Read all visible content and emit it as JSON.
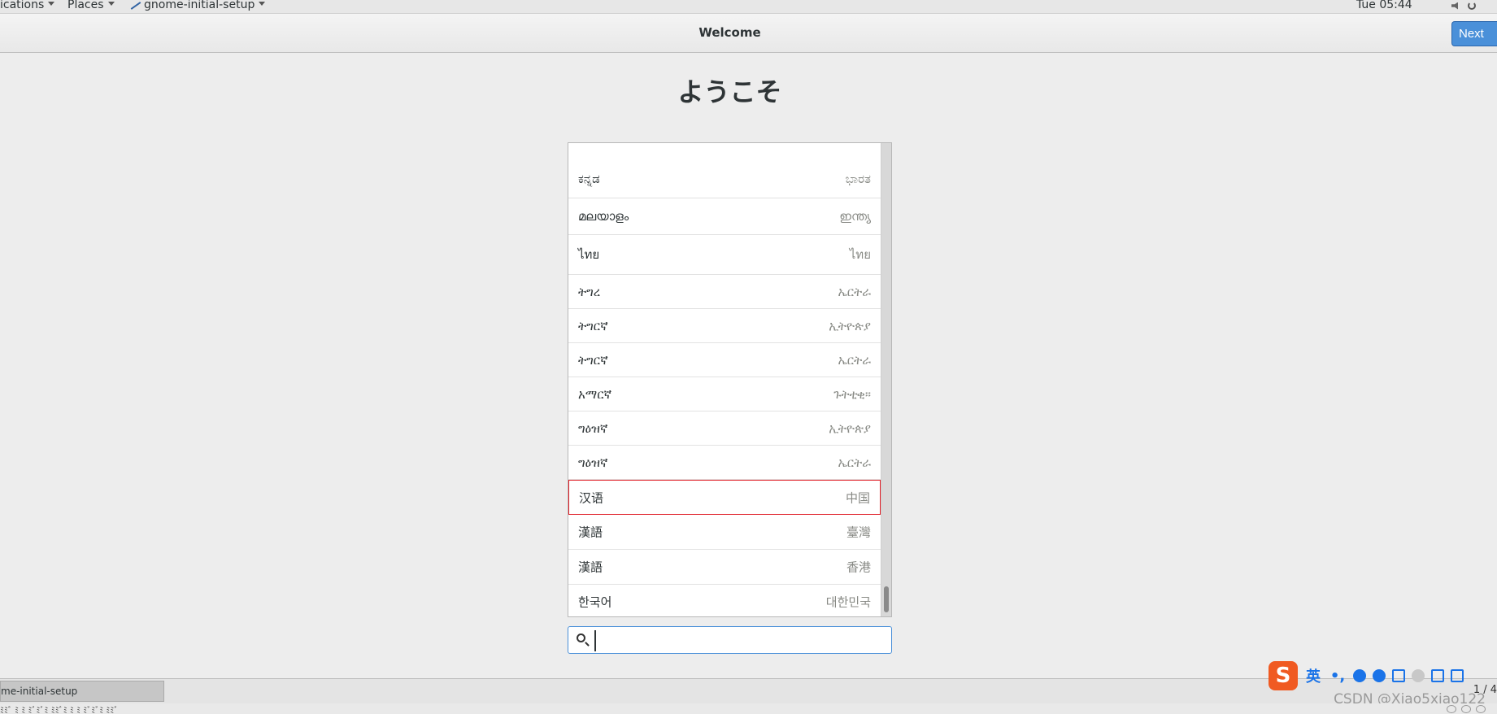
{
  "top_panel": {
    "applications": "ications",
    "places": "Places",
    "app_menu": "gnome-initial-setup",
    "clock": "Tue 05:44"
  },
  "header": {
    "title": "Welcome",
    "next_label": "Next"
  },
  "welcome": {
    "title": "ようこそ"
  },
  "languages": [
    {
      "name": "ಕನ್ನಡ",
      "region": "ಭಾರತ"
    },
    {
      "name": "മലയാളം",
      "region": "ഇന്ത്യ"
    },
    {
      "name": "ไทย",
      "region": "ไทย"
    },
    {
      "name": "ትግረ",
      "region": "ኤርትራ"
    },
    {
      "name": "ትግርኛ",
      "region": "ኢትዮጵያ"
    },
    {
      "name": "ትግርኛ",
      "region": "ኤርትራ"
    },
    {
      "name": "አማርኛ",
      "region": "ጉትቲቂ።"
    },
    {
      "name": "ግዕዝኛ",
      "region": "ኢትዮጵያ"
    },
    {
      "name": "ግዕዝኛ",
      "region": "ኤርትራ"
    },
    {
      "name": "汉语",
      "region": "中国",
      "selected": true
    },
    {
      "name": "漢語",
      "region": "臺灣"
    },
    {
      "name": "漢語",
      "region": "香港"
    },
    {
      "name": "한국어",
      "region": "대한민국"
    }
  ],
  "search": {
    "value": "",
    "placeholder": ""
  },
  "taskbar": {
    "task_label": "me-initial-setup",
    "page_indicator": "1 / 4"
  },
  "bottom": {
    "text": "ﾐﾐﾞ ﾐ ﾐ ﾐﾞﾐﾞﾐ ﾐﾐﾞﾐ ﾐ ﾐ ﾐﾞﾐﾞﾐ ﾐﾐﾞ"
  },
  "watermark": "CSDN @Xiao5xiao122",
  "ime": {
    "logo": "S",
    "lang": "英",
    "punct": "•,"
  },
  "colors": {
    "accent": "#4a90d9",
    "selection_border": "#e01b24",
    "ime_logo": "#f05a22"
  }
}
